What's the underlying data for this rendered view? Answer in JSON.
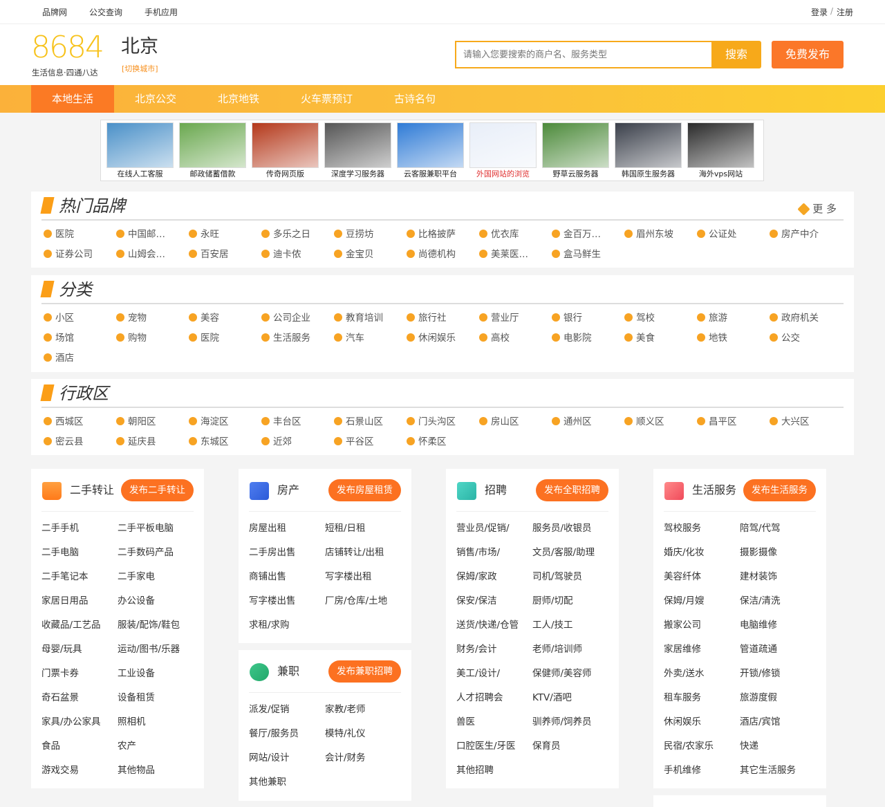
{
  "topbar": {
    "links": [
      "品牌网",
      "公交查询",
      "手机应用"
    ],
    "login": "登录",
    "sep": "/",
    "register": "注册"
  },
  "header": {
    "logo": "8684",
    "logo_sub": "生活信息·四通八达",
    "city": "北京",
    "switch_city": "[切换城市]",
    "search_placeholder": "请输入您要搜索的商户名、服务类型",
    "search_button": "搜索",
    "free_post": "免费发布"
  },
  "nav": {
    "items": [
      "本地生活",
      "北京公交",
      "北京地铁",
      "火车票预订",
      "古诗名句"
    ]
  },
  "ads": [
    {
      "caption": "在线人工客服",
      "color": "#4a90c8",
      "red": false
    },
    {
      "caption": "邮政储蓄借款",
      "color": "#6aa84f",
      "red": false
    },
    {
      "caption": "传奇网页版",
      "color": "#b4381a",
      "red": false
    },
    {
      "caption": "深度学习服务器",
      "color": "#555555",
      "red": false
    },
    {
      "caption": "云客服兼职平台",
      "color": "#2f7bd6",
      "red": false
    },
    {
      "caption": "外国网站的浏览",
      "color": "#e8eef8",
      "red": true
    },
    {
      "caption": "野草云服务器",
      "color": "#4c8a3a",
      "red": false
    },
    {
      "caption": "韩国原生服务器",
      "color": "#3a3f4a",
      "red": false
    },
    {
      "caption": "海外vps网站",
      "color": "#2a2a2a",
      "red": false
    }
  ],
  "hot_brands": {
    "title": "热门品牌",
    "more": "更 多",
    "items": [
      "医院",
      "中国邮…",
      "永旺",
      "多乐之日",
      "豆捞坊",
      "比格披萨",
      "优衣库",
      "金百万…",
      "眉州东坡",
      "公证处",
      "房产中介",
      "证券公司",
      "山姆会…",
      "百安居",
      "迪卡侬",
      "金宝贝",
      "尚德机构",
      "美莱医…",
      "盒马鲜生"
    ]
  },
  "categories": {
    "title": "分类",
    "items": [
      "小区",
      "宠物",
      "美容",
      "公司企业",
      "教育培训",
      "旅行社",
      "营业厅",
      "银行",
      "驾校",
      "旅游",
      "政府机关",
      "场馆",
      "购物",
      "医院",
      "生活服务",
      "汽车",
      "休闲娱乐",
      "高校",
      "电影院",
      "美食",
      "地铁",
      "公交",
      "酒店"
    ]
  },
  "districts": {
    "title": "行政区",
    "items": [
      "西城区",
      "朝阳区",
      "海淀区",
      "丰台区",
      "石景山区",
      "门头沟区",
      "房山区",
      "通州区",
      "顺义区",
      "昌平区",
      "大兴区",
      "密云县",
      "延庆县",
      "东城区",
      "近郊",
      "平谷区",
      "怀柔区"
    ]
  },
  "cards": {
    "second_hand": {
      "title": "二手转让",
      "button": "发布二手转让",
      "links": [
        "二手手机",
        "二手平板电脑",
        "二手电脑",
        "二手数码产品",
        "二手笔记本",
        "二手家电",
        "家居日用品",
        "办公设备",
        "收藏品/工艺品",
        "服装/配饰/鞋包",
        "母婴/玩具",
        "运动/图书/乐器",
        "门票卡券",
        "工业设备",
        "奇石盆景",
        "设备租赁",
        "家具/办公家具",
        "照相机",
        "食品",
        "农产",
        "游戏交易",
        "其他物品"
      ]
    },
    "house": {
      "title": "房产",
      "button": "发布房屋租赁",
      "links": [
        "房屋出租",
        "短租/日租",
        "二手房出售",
        "店铺转让/出租",
        "商铺出售",
        "写字楼出租",
        "写字楼出售",
        "厂房/仓库/土地",
        "求租/求购"
      ]
    },
    "parttime": {
      "title": "兼职",
      "button": "发布兼职招聘",
      "links": [
        "派发/促销",
        "家教/老师",
        "餐厅/服务员",
        "模特/礼仪",
        "网站/设计",
        "会计/财务",
        "其他兼职"
      ]
    },
    "jobs": {
      "title": "招聘",
      "button": "发布全职招聘",
      "links": [
        "营业员/促销/",
        "服务员/收银员",
        "销售/市场/",
        "文员/客服/助理",
        "保姆/家政",
        "司机/驾驶员",
        "保安/保洁",
        "厨师/切配",
        "送货/快递/仓管",
        "工人/技工",
        "财务/会计",
        "老师/培训师",
        "美工/设计/",
        "保健师/美容师",
        "人才招聘会",
        "KTV/酒吧",
        "兽医",
        "驯养师/饲养员",
        "口腔医生/牙医",
        "保育员",
        "其他招聘"
      ]
    },
    "life": {
      "title": "生活服务",
      "button": "发布生活服务",
      "links": [
        "驾校服务",
        "陪驾/代驾",
        "婚庆/化妆",
        "摄影摄像",
        "美容纤体",
        "建材装饰",
        "保姆/月嫂",
        "保洁/清洗",
        "搬家公司",
        "电脑维修",
        "家居维修",
        "管道疏通",
        "外卖/送水",
        "开锁/修锁",
        "租车服务",
        "旅游度假",
        "休闲娱乐",
        "酒店/宾馆",
        "民宿/农家乐",
        "快递",
        "手机维修",
        "其它生活服务"
      ]
    }
  },
  "colors": {
    "accent": "#fb7729",
    "brand_yellow": "#f7c21b",
    "dot": "#f7a323"
  }
}
